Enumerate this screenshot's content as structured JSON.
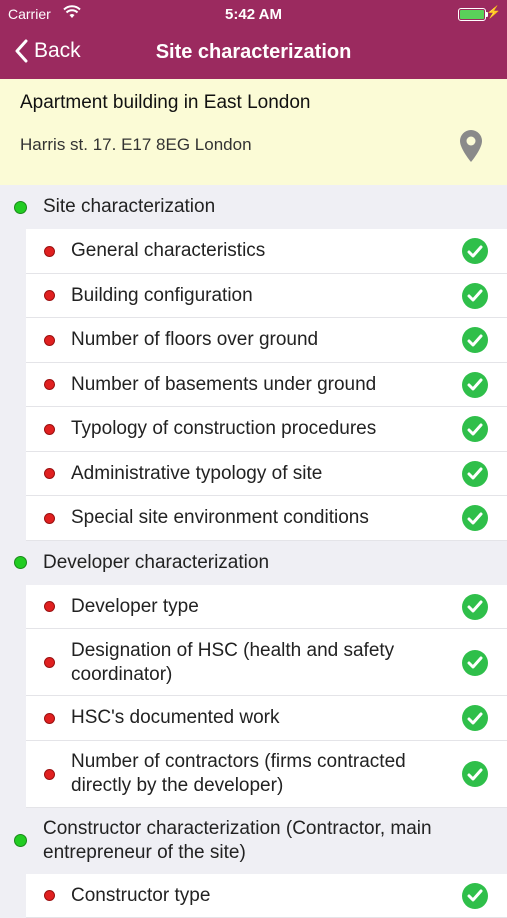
{
  "status_bar": {
    "carrier": "Carrier",
    "time": "5:42 AM"
  },
  "nav": {
    "back_label": "Back",
    "title": "Site characterization"
  },
  "site": {
    "name": "Apartment building in East London",
    "address": "Harris st. 17. E17 8EG London"
  },
  "colors": {
    "nav_bg": "#9b2a5f",
    "header_bg": "#fbfbd6",
    "section_dot": "#22cc22",
    "item_dot": "#e02020",
    "check": "#2fbf4a"
  },
  "sections": [
    {
      "label": "Site characterization",
      "items": [
        {
          "label": "General characteristics",
          "done": true
        },
        {
          "label": "Building configuration",
          "done": true
        },
        {
          "label": "Number of floors over ground",
          "done": true
        },
        {
          "label": "Number of basements under ground",
          "done": true
        },
        {
          "label": "Typology of construction procedures",
          "done": true
        },
        {
          "label": "Administrative typology of site",
          "done": true
        },
        {
          "label": "Special site environment conditions",
          "done": true
        }
      ]
    },
    {
      "label": "Developer characterization",
      "items": [
        {
          "label": "Developer type",
          "done": true
        },
        {
          "label": "Designation of HSC (health and safety coordinator)",
          "done": true
        },
        {
          "label": "HSC's documented work",
          "done": true
        },
        {
          "label": "Number of contractors (firms contracted directly by the developer)",
          "done": true
        }
      ]
    },
    {
      "label": "Constructor characterization (Contractor, main entrepreneur of the site)",
      "items": [
        {
          "label": "Constructor type",
          "done": true
        }
      ]
    }
  ]
}
